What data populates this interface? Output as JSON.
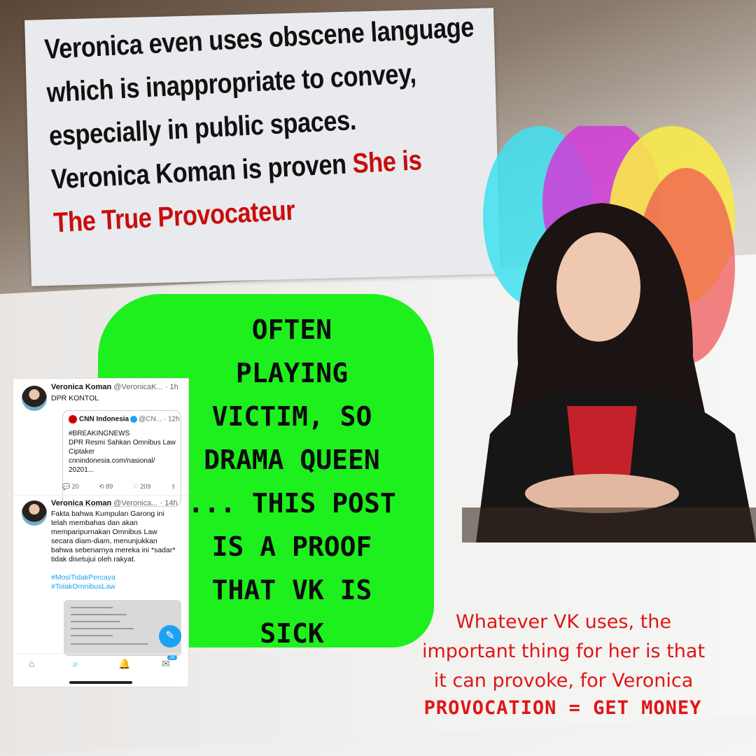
{
  "headline": {
    "line1": "Veronica even uses obscene language",
    "line2": "which is inappropriate to convey,",
    "line3": "especially in public spaces.",
    "line4_black": "Veronica Koman is proven ",
    "line4_red": "She is",
    "line5_red": "The True Provocateur"
  },
  "green_box": {
    "lines": [
      "OFTEN",
      "PLAYING",
      "VICTIM, SO",
      "DRAMA QUEEN",
      "... THIS POST",
      "IS A PROOF",
      "THAT VK IS",
      "SICK"
    ]
  },
  "tweet": {
    "post1": {
      "name": "Veronica Koman",
      "handle": "@VeronicaK...",
      "time": "· 1h",
      "text": "DPR KONTOL",
      "quote": {
        "source": "CNN Indonesia",
        "handle": "@CN...",
        "time": "· 12h",
        "line1": "#BREAKINGNEWS",
        "line2": "DPR Resmi Sahkan Omnibus Law",
        "line3": "Ciptaker",
        "line4": "cnnindonesia.com/nasional/",
        "line5": "20201..."
      },
      "replies": "20",
      "retweets": "89",
      "likes": "209"
    },
    "post2": {
      "name": "Veronica Koman",
      "handle": "@Veronica...",
      "time": "· 14h",
      "line1": "Fakta bahwa Kumpulan Garong ini",
      "line2": "telah membahas dan akan",
      "line3": "memparipurnakan Omnibus Law",
      "line4": "secara diam-diam, menunjukkan",
      "line5": "bahwa sebenarnya mereka ini *sadar*",
      "line6": "tidak disetujui oleh rakyat.",
      "hashtag1": "#MosiTidakPercaya",
      "hashtag2": "#TolakOmnibusLaw"
    },
    "badge_count": "16"
  },
  "red_caption": {
    "line1": "Whatever VK uses, the",
    "line2": "important thing for her is that",
    "line3": "it can provoke, for Veronica",
    "line4": "PROVOCATION = GET MONEY"
  },
  "colors": {
    "green": "#1ef01e",
    "red": "#e01515",
    "headline_red": "#c80d0d"
  }
}
